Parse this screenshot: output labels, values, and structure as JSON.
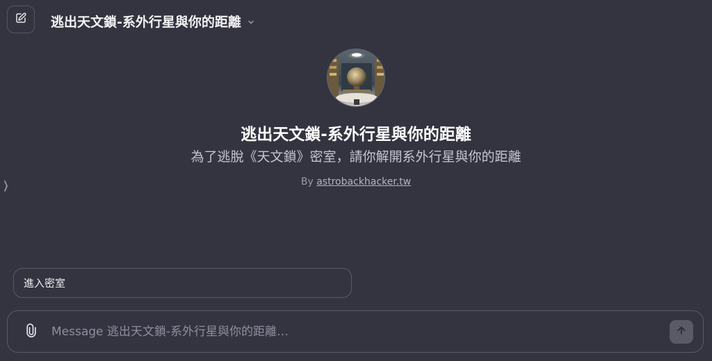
{
  "header": {
    "title": "逃出天文鎖-系外行星與你的距離",
    "new_chat_icon": "edit-pencil-icon",
    "dropdown_icon": "chevron-down-icon"
  },
  "gpt": {
    "name": "逃出天文鎖-系外行星與你的距離",
    "description": "為了逃脫《天文鎖》密室，請你解開系外行星與你的距離",
    "author_prefix": "By",
    "author_link": "astrobackhacker.tw",
    "avatar_icon": "escape-room-avatar"
  },
  "starters": [
    {
      "label": "進入密室"
    }
  ],
  "composer": {
    "placeholder": "Message 逃出天文鎖-系外行星與你的距離…",
    "value": "",
    "attach_icon": "paperclip-icon",
    "send_icon": "arrow-up-icon"
  },
  "sidebar_toggle_icon": "chevron-right-icon",
  "colors": {
    "background": "#343440",
    "border": "#5b5b66",
    "text": "#ececf1",
    "muted": "#8e8ea0",
    "send_button": "#5a5a66"
  }
}
